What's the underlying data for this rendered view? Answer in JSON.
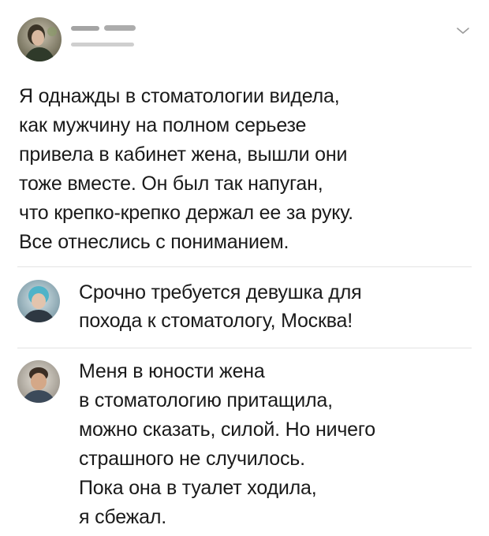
{
  "post": {
    "text": "Я однажды в стоматологии видела,\nкак мужчину на полном серьезе\nпривела в кабинет жена, вышли они\nтоже вместе. Он был так напуган,\nчто крепко-крепко держал ее за руку.\nВсе отнеслись с пониманием."
  },
  "replies": [
    {
      "text": "Срочно требуется девушка для\nпохода к стоматологу, Москва!"
    },
    {
      "text": "Меня в юности жена\nв стоматологию притащила,\nможно сказать, силой. Но ничего\nстрашного не случилось.\nПока она в туалет ходила,\nя сбежал."
    }
  ],
  "icons": {
    "menu": "chevron-down-icon"
  },
  "colors": {
    "divider": "#e3e3e3",
    "text": "#1a1a1a",
    "chevron": "#9a9a9a"
  }
}
